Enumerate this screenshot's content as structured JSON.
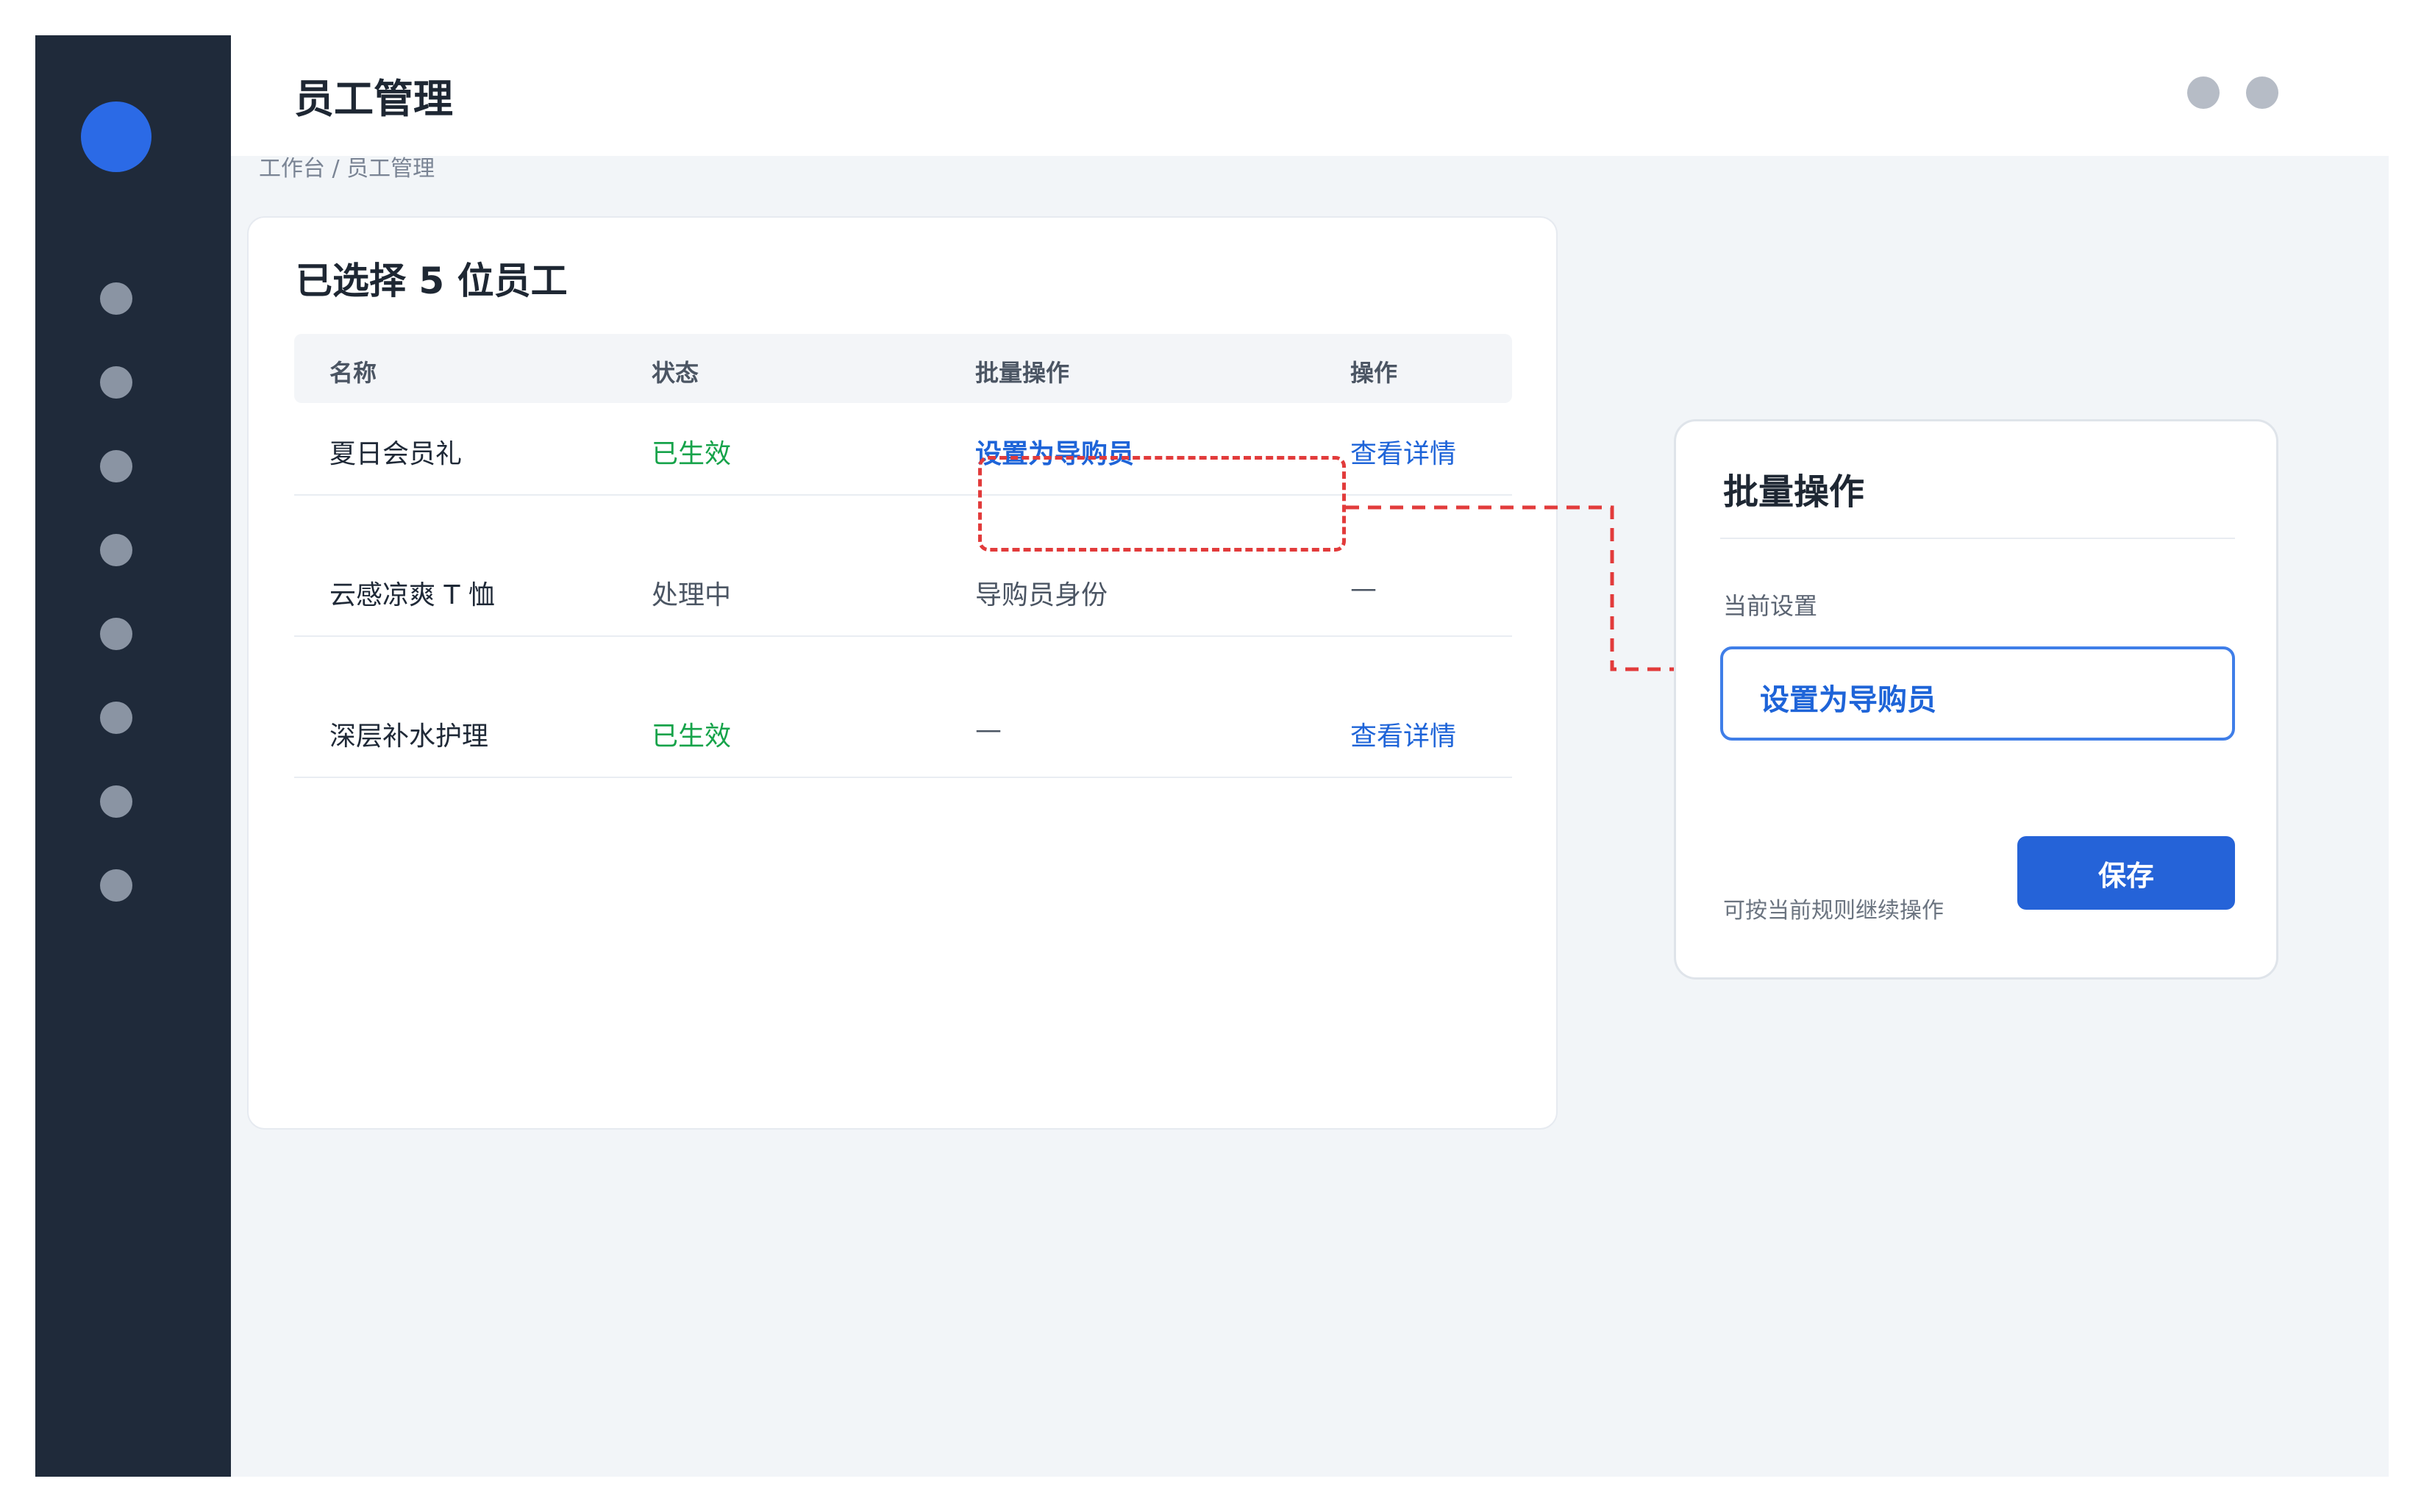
{
  "header": {
    "title": "员工管理"
  },
  "breadcrumb": "工作台 / 员工管理",
  "card": {
    "title": "已选择 5 位员工",
    "columns": [
      "名称",
      "状态",
      "批量操作",
      "操作"
    ],
    "rows": [
      {
        "name": "夏日会员礼",
        "status": "已生效",
        "batch": "设置为导购员",
        "action": "查看详情"
      },
      {
        "name": "云感凉爽 T 恤",
        "status": "处理中",
        "batch": "导购员身份",
        "action": "—"
      },
      {
        "name": "深层补水护理",
        "status": "已生效",
        "batch": "—",
        "action": "查看详情"
      }
    ]
  },
  "panel": {
    "title": "批量操作",
    "label": "当前设置",
    "value": "设置为导购员",
    "hint": "可按当前规则继续操作",
    "save_label": "保存"
  },
  "colors": {
    "sidebar": "#1f2a3a",
    "accent": "#2563d8",
    "success": "#16a34a",
    "highlight": "#e23b3b"
  }
}
